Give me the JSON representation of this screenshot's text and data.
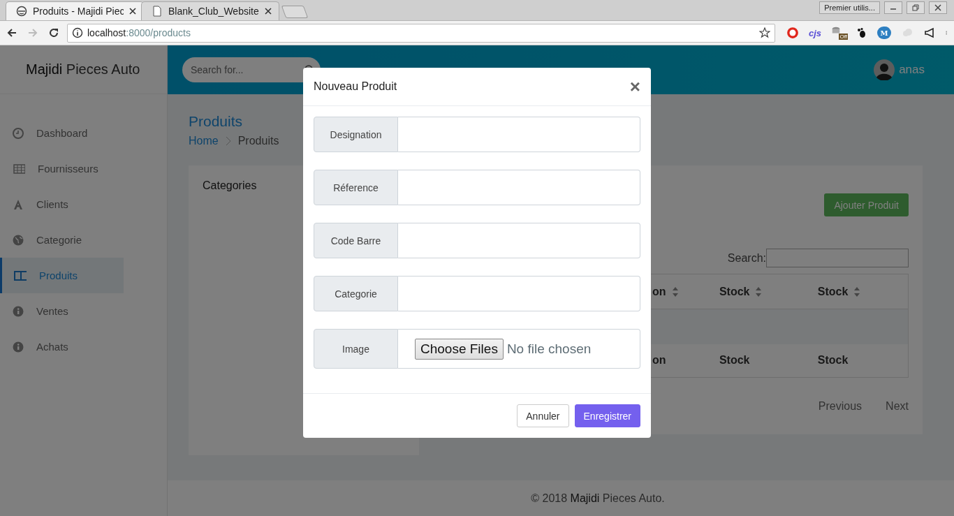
{
  "browser": {
    "tabs": [
      {
        "title": "Produits - Majidi Piec",
        "selected": true
      },
      {
        "title": "Blank_Club_Website",
        "selected": false
      }
    ],
    "profile_button": "Premier utilis...",
    "address": {
      "host": "localhost",
      "path": ":8000/products"
    },
    "extensions": {
      "cjs": "cjs",
      "badge": "Off",
      "cloud_letter": "M"
    }
  },
  "app": {
    "brand": "**Majidi** Pieces Auto",
    "search": {
      "placeholder": "Search for..."
    },
    "user": "anas",
    "sidebar": {
      "items": [
        {
          "label": "Dashboard",
          "selected": false
        },
        {
          "label": "Fournisseurs",
          "selected": false
        },
        {
          "label": "Clients",
          "selected": false
        },
        {
          "label": "Categorie",
          "selected": false
        },
        {
          "label": "Produits",
          "selected": true
        },
        {
          "label": "Ventes",
          "selected": false
        },
        {
          "label": "Achats",
          "selected": false
        }
      ]
    },
    "page_title": "Produits",
    "breadcrumb": [
      "Home",
      "Produits"
    ],
    "categories_title": "Categories",
    "add_button": "Ajouter Produit",
    "table_search_label": "Search:",
    "table": {
      "columns": [
        "on",
        "Stock",
        "Stock"
      ],
      "footer": [
        "on",
        "Stock",
        "Stock"
      ]
    },
    "pagination": [
      "Previous",
      "Next"
    ],
    "footer": "© 2018 **Majidi** Pieces Auto."
  },
  "modal": {
    "title": "Nouveau Produit",
    "close": "×",
    "fields": [
      {
        "label": "Designation",
        "kind": "text"
      },
      {
        "label": "Réference",
        "kind": "text"
      },
      {
        "label": "Code Barre",
        "kind": "text"
      },
      {
        "label": "Categorie",
        "kind": "text"
      },
      {
        "label": "Image",
        "kind": "file",
        "button": "Choose Files",
        "status": "No file chosen"
      }
    ],
    "buttons": [
      {
        "label": "Annuler",
        "kind": "secondary"
      },
      {
        "label": "Enregistrer",
        "kind": "primary"
      }
    ]
  }
}
